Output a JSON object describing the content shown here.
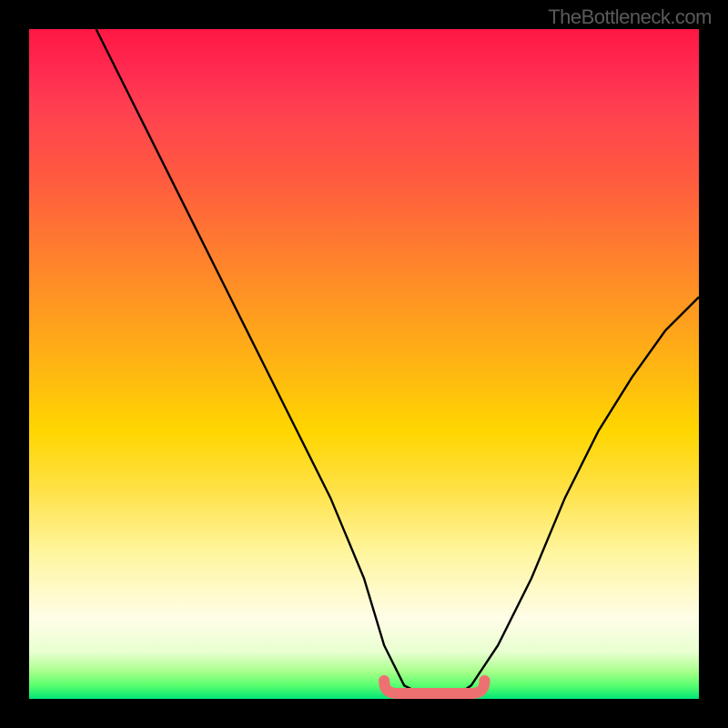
{
  "watermark": "TheBottleneck.com",
  "chart_data": {
    "type": "line",
    "title": "",
    "xlabel": "",
    "ylabel": "",
    "xlim": [
      0,
      100
    ],
    "ylim": [
      0,
      100
    ],
    "series": [
      {
        "name": "curve",
        "x": [
          10,
          15,
          20,
          25,
          30,
          35,
          40,
          45,
          50,
          53,
          56,
          60,
          63,
          66,
          70,
          75,
          80,
          85,
          90,
          95,
          100
        ],
        "y": [
          100,
          90,
          80,
          70,
          60,
          50,
          40,
          30,
          18,
          8,
          2,
          0,
          0,
          2,
          8,
          18,
          30,
          40,
          48,
          55,
          60
        ]
      }
    ],
    "trough_marker": {
      "x_start": 53,
      "x_end": 68,
      "y": 0
    },
    "gradient": {
      "top": "#ff1744",
      "mid": "#ffd600",
      "bottom": "#00e676"
    }
  }
}
